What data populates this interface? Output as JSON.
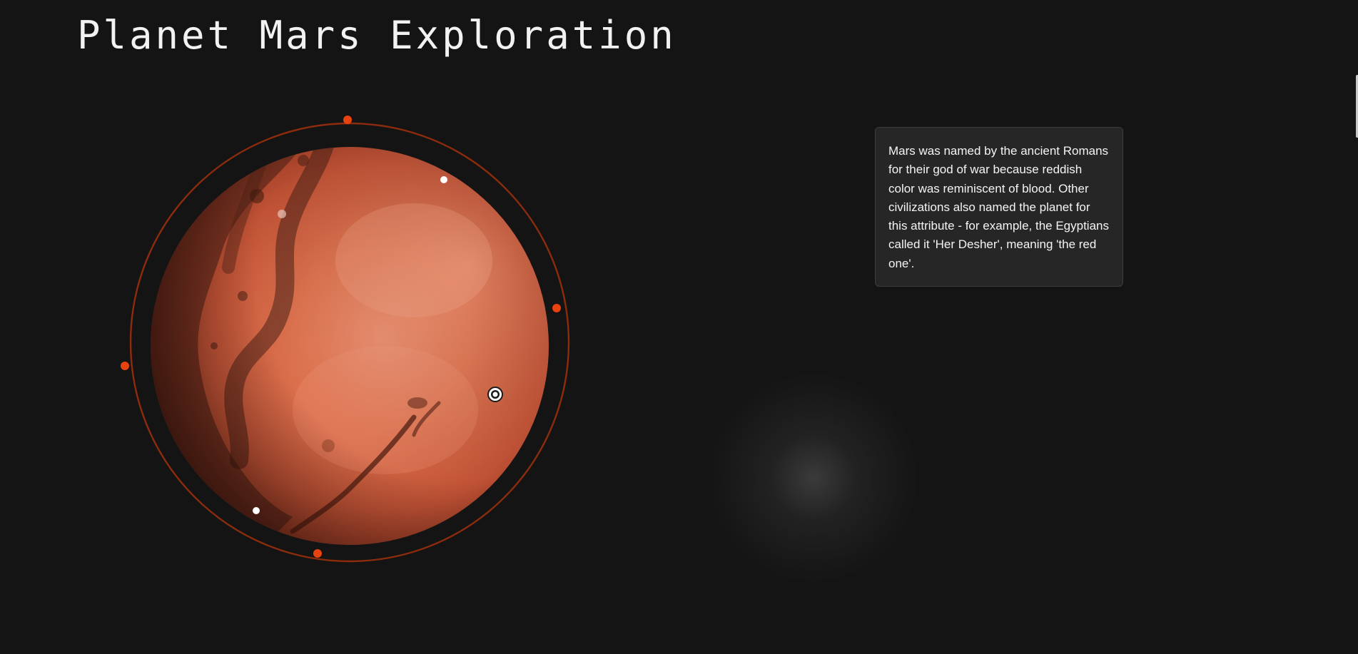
{
  "header": {
    "title": "Planet Mars Exploration"
  },
  "info_card": {
    "text": "Mars was named by the ancient Romans for their god of war because reddish color was reminiscent of blood. Other civilizations also named the planet for this attribute - for example, the Egyptians called it 'Her Desher', meaning 'the red one'."
  },
  "planet": {
    "name_icon": "mars-globe",
    "surface_color": "#cf5e3c",
    "orbit_color": "#d9420c",
    "orbit_marker_color": "#e8420f",
    "hotspot_color": "#ffffff"
  },
  "colors": {
    "background": "#141414",
    "card_background": "#262626",
    "card_border": "#3c3c3c",
    "text": "#f4f4f4"
  }
}
